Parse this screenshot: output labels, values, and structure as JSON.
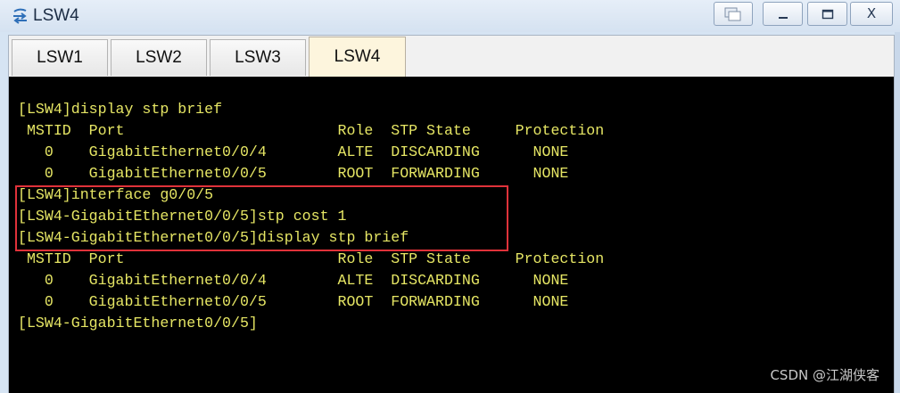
{
  "window": {
    "title": "LSW4",
    "icon": "switch-icon"
  },
  "title_buttons": {
    "restore_icon": "restore-window-icon",
    "minimize_icon": "minimize-icon",
    "maximize_icon": "maximize-icon",
    "close_label": "X"
  },
  "tabs": [
    {
      "label": "LSW1",
      "active": false
    },
    {
      "label": "LSW2",
      "active": false
    },
    {
      "label": "LSW3",
      "active": false
    },
    {
      "label": "LSW4",
      "active": true
    }
  ],
  "terminal": {
    "lines": [
      "[LSW4]display stp brief",
      " MSTID  Port                        Role  STP State     Protection",
      "   0    GigabitEthernet0/0/4        ALTE  DISCARDING      NONE",
      "   0    GigabitEthernet0/0/5        ROOT  FORWARDING      NONE",
      "[LSW4]interface g0/0/5",
      "[LSW4-GigabitEthernet0/0/5]stp cost 1",
      "[LSW4-GigabitEthernet0/0/5]display stp brief",
      " MSTID  Port                        Role  STP State     Protection",
      "   0    GigabitEthernet0/0/4        ALTE  DISCARDING      NONE",
      "   0    GigabitEthernet0/0/5        ROOT  FORWARDING      NONE",
      "[LSW4-GigabitEthernet0/0/5]"
    ],
    "text_color": "#e6e664",
    "background": "#000000",
    "highlight_color": "#e0323a"
  },
  "watermark": "CSDN @江湖侠客"
}
